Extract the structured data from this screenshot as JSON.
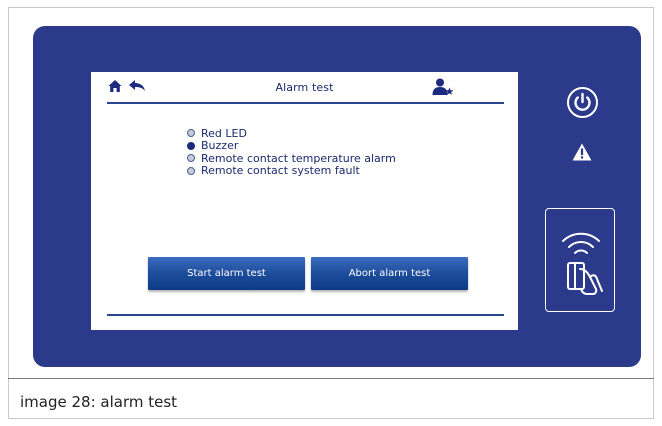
{
  "screen": {
    "title": "Alarm test",
    "options": [
      {
        "label": "Red LED",
        "selected": false
      },
      {
        "label": "Buzzer",
        "selected": true
      },
      {
        "label": "Remote contact temperature alarm",
        "selected": false
      },
      {
        "label": "Remote contact system fault",
        "selected": false
      }
    ],
    "start_button": "Start alarm test",
    "abort_button": "Abort alarm test"
  },
  "icons": {
    "home": "home-icon",
    "back": "back-arrow-icon",
    "user": "user-star-icon",
    "power": "power-icon",
    "warning": "warning-icon",
    "rfid": "rfid-card-reader-icon"
  },
  "colors": {
    "panel": "#2b3a8a",
    "accent": "#1c2a80",
    "button": "#1f4f9d"
  },
  "caption": "image 28: alarm test"
}
